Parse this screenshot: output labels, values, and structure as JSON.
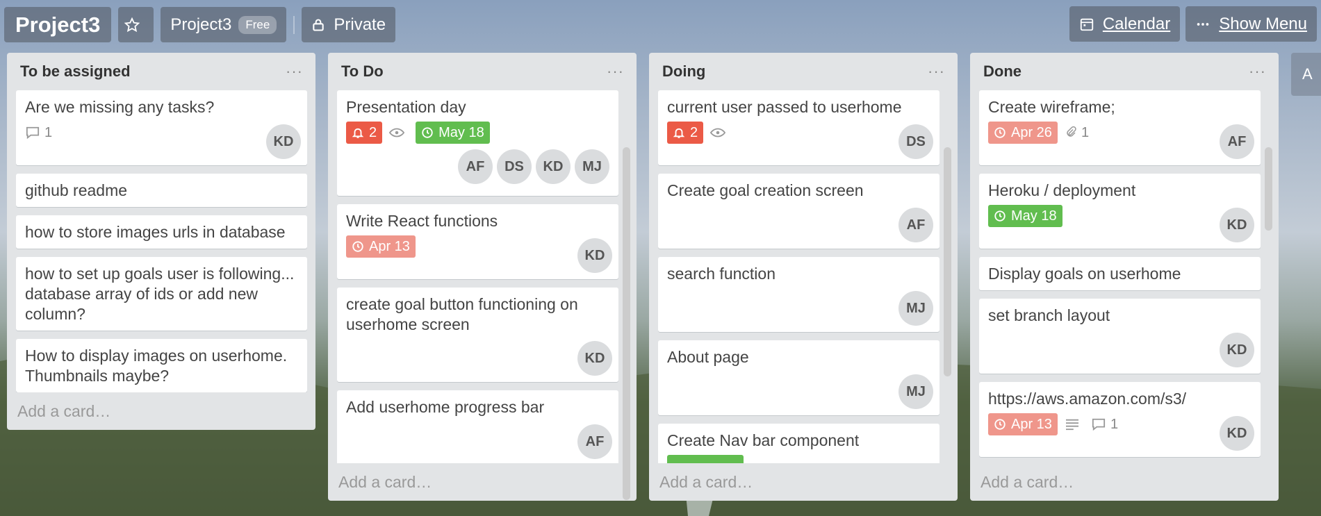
{
  "header": {
    "board_title": "Project3",
    "team_name": "Project3",
    "team_badge": "Free",
    "visibility": "Private",
    "calendar_label": "Calendar",
    "menu_label": "Show Menu"
  },
  "lists": [
    {
      "title": "To be assigned",
      "menu": "···",
      "add_card": "Add a card…",
      "cards": [
        {
          "title": "Are we missing any tasks?",
          "comments": "1",
          "members": [
            "KD"
          ]
        },
        {
          "title": "github readme"
        },
        {
          "title": "how to store images urls in database"
        },
        {
          "title": "how to set up goals user is following... database array of ids or add new column?"
        },
        {
          "title": "How to display images on userhome. Thumbnails maybe?"
        }
      ]
    },
    {
      "title": "To Do",
      "menu": "···",
      "add_card": "Add a card…",
      "cards": [
        {
          "title": "Presentation day",
          "notifications": "2",
          "due": "May 18",
          "members": [
            "AF",
            "DS",
            "KD",
            "MJ"
          ]
        },
        {
          "title": "Write React functions",
          "due": "Apr 13",
          "members": [
            "KD"
          ]
        },
        {
          "title": "create goal button functioning on userhome screen",
          "members": [
            "KD"
          ]
        },
        {
          "title": "Add userhome progress bar",
          "members": [
            "AF"
          ]
        }
      ]
    },
    {
      "title": "Doing",
      "menu": "···",
      "add_card": "Add a card…",
      "cards": [
        {
          "title": "current user passed to userhome",
          "notifications": "2",
          "members": [
            "DS"
          ]
        },
        {
          "title": "Create goal creation screen",
          "members": [
            "AF"
          ]
        },
        {
          "title": "search function",
          "members": [
            "MJ"
          ]
        },
        {
          "title": "About page",
          "members": [
            "MJ"
          ]
        },
        {
          "title": "Create Nav bar component"
        }
      ]
    },
    {
      "title": "Done",
      "menu": "···",
      "add_card": "Add a card…",
      "cards": [
        {
          "title": "Create wireframe;",
          "due": "Apr 26",
          "attachments": "1",
          "members": [
            "AF"
          ]
        },
        {
          "title": "Heroku / deployment",
          "due": "May 18",
          "members": [
            "KD"
          ]
        },
        {
          "title": "Display goals on userhome"
        },
        {
          "title": "set branch layout",
          "members": [
            "KD"
          ]
        },
        {
          "title": "https://aws.amazon.com/s3/",
          "due": "Apr 13",
          "comments": "1",
          "members": [
            "KD"
          ]
        }
      ]
    }
  ],
  "edge_tab": "A",
  "colors": {
    "red": "#eb5a46",
    "pink": "#ef968b",
    "green": "#61bd4f",
    "list_bg": "#e2e4e6"
  }
}
